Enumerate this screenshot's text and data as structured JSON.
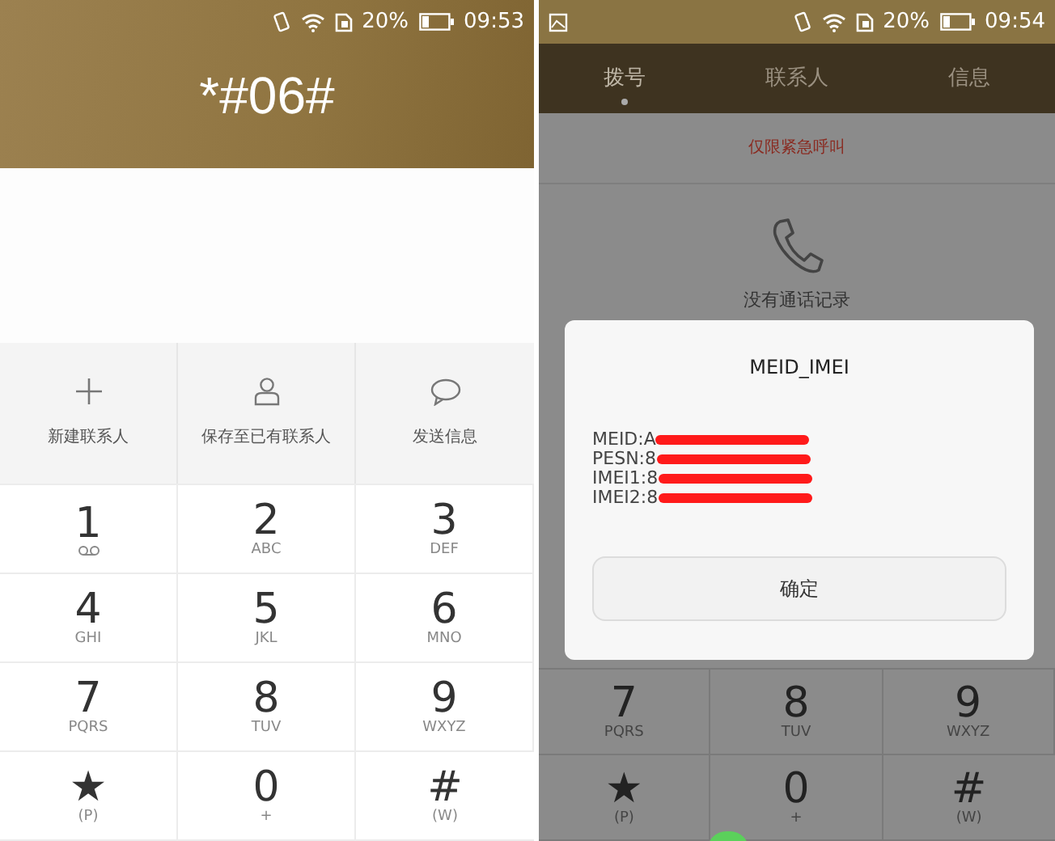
{
  "left": {
    "status_bar": {
      "battery": "20%",
      "time": "09:53"
    },
    "dialed": "*#06#",
    "actions": [
      {
        "kind": "plus",
        "label": "新建联系人"
      },
      {
        "kind": "person",
        "label": "保存至已有联系人"
      },
      {
        "kind": "chat",
        "label": "发送信息"
      }
    ],
    "keys": [
      {
        "kind": "voicemail",
        "digit": "1"
      },
      {
        "kind": "letters",
        "digit": "2",
        "letters": "ABC"
      },
      {
        "kind": "letters",
        "digit": "3",
        "letters": "DEF"
      },
      {
        "kind": "letters",
        "digit": "4",
        "letters": "GHI"
      },
      {
        "kind": "letters",
        "digit": "5",
        "letters": "JKL"
      },
      {
        "kind": "letters",
        "digit": "6",
        "letters": "MNO"
      },
      {
        "kind": "letters",
        "digit": "7",
        "letters": "PQRS"
      },
      {
        "kind": "letters",
        "digit": "8",
        "letters": "TUV"
      },
      {
        "kind": "letters",
        "digit": "9",
        "letters": "WXYZ"
      },
      {
        "kind": "letters",
        "digit": "★",
        "letters": "(P)"
      },
      {
        "kind": "letters",
        "digit": "0",
        "letters": "+"
      },
      {
        "kind": "letters",
        "digit": "#",
        "letters": "(W)"
      }
    ]
  },
  "right": {
    "status_bar": {
      "battery": "20%",
      "time": "09:54"
    },
    "tabs": [
      {
        "label": "拨号",
        "selected": true
      },
      {
        "label": "联系人",
        "selected": false
      },
      {
        "label": "信息",
        "selected": false
      }
    ],
    "notice": "仅限紧急呼叫",
    "empty_text": "没有通话记录",
    "dialog": {
      "title": "MEID_IMEI",
      "lines": [
        {
          "label": "MEID:A"
        },
        {
          "label": "PESN:8"
        },
        {
          "label": "IMEI1:8"
        },
        {
          "label": "IMEI2:8"
        }
      ],
      "button": "确定"
    },
    "keys": [
      {
        "kind": "letters",
        "digit": "7",
        "letters": "PQRS"
      },
      {
        "kind": "letters",
        "digit": "8",
        "letters": "TUV"
      },
      {
        "kind": "letters",
        "digit": "9",
        "letters": "WXYZ"
      },
      {
        "kind": "letters",
        "digit": "★",
        "letters": "(P)"
      },
      {
        "kind": "letters",
        "digit": "0",
        "letters": "+"
      },
      {
        "kind": "letters",
        "digit": "#",
        "letters": "(W)"
      }
    ]
  }
}
